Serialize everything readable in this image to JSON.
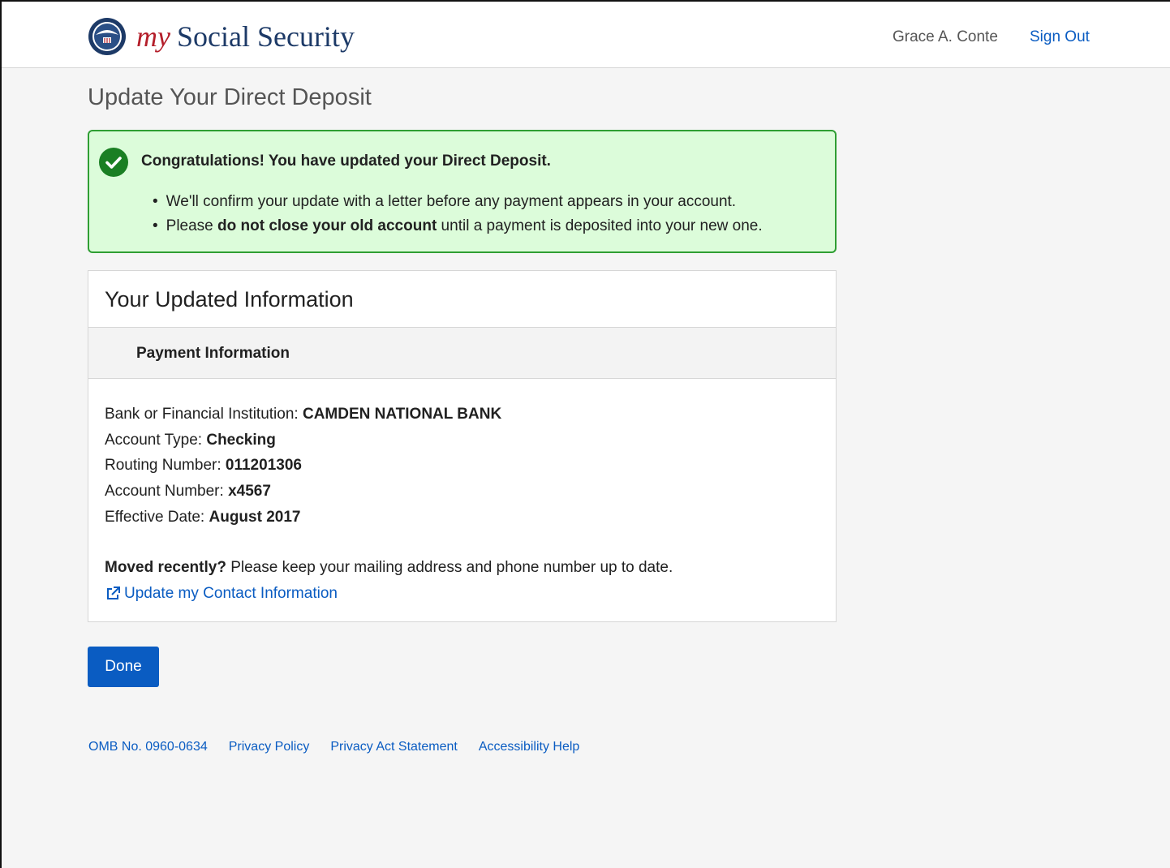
{
  "header": {
    "brand_my": "my",
    "brand_name": "Social Security",
    "user_name": "Grace A. Conte",
    "signout_label": "Sign Out"
  },
  "page": {
    "title": "Update Your Direct Deposit"
  },
  "alert": {
    "title": "Congratulations! You have updated your Direct Deposit.",
    "item1": "We'll confirm your update with a letter before any payment appears in your account.",
    "item2_pre": "Please ",
    "item2_bold": "do not close your old account",
    "item2_post": " until a payment is deposited into your new one."
  },
  "card": {
    "title": "Your Updated Information",
    "subtitle": "Payment Information",
    "fields": {
      "bank_label": "Bank or Financial Institution: ",
      "bank_value": "CAMDEN NATIONAL BANK",
      "type_label": "Account Type: ",
      "type_value": "Checking",
      "routing_label": "Routing Number: ",
      "routing_value": "011201306",
      "account_label": "Account Number: ",
      "account_value": "x4567",
      "date_label": "Effective Date: ",
      "date_value": "August 2017"
    },
    "moved_bold": "Moved recently?",
    "moved_text": " Please keep your mailing address and phone number up to date.",
    "contact_link": "Update my Contact Information"
  },
  "actions": {
    "done_label": "Done"
  },
  "footer": {
    "omb": "OMB No. 0960-0634",
    "privacy_policy": "Privacy Policy",
    "privacy_act": "Privacy Act Statement",
    "accessibility": "Accessibility Help"
  },
  "colors": {
    "brand_blue": "#1d3a67",
    "brand_red": "#b41e2a",
    "link_blue": "#0a5cc2",
    "success_bg": "#dcfcda",
    "success_border": "#2f9e33"
  },
  "icons": {
    "seal": "ssa-seal-icon",
    "success": "check-circle-icon",
    "external": "external-link-icon"
  }
}
